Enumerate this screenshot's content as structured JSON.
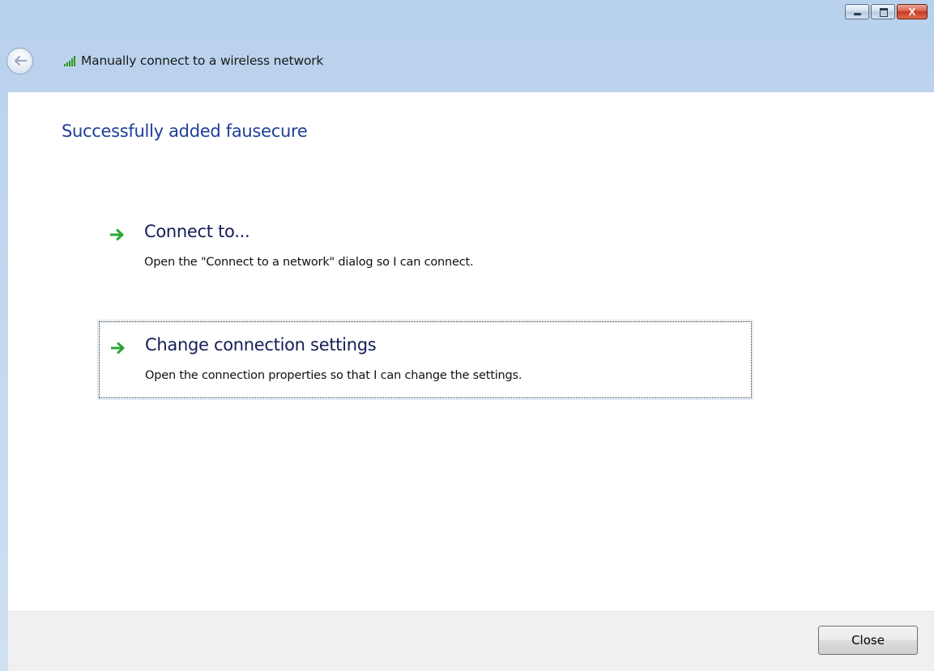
{
  "window": {
    "controls": {
      "close_glyph": "X"
    }
  },
  "header": {
    "title": "Manually connect to a wireless network",
    "back_icon": "back-arrow-icon",
    "signal_icon": "wireless-signal-icon"
  },
  "main": {
    "heading": "Successfully added fausecure",
    "options": [
      {
        "title": "Connect to...",
        "description": "Open the \"Connect to a network\" dialog so I can connect.",
        "icon": "green-arrow-icon"
      },
      {
        "title": "Change connection settings",
        "description": "Open the connection properties so that I can change the settings.",
        "icon": "green-arrow-icon",
        "focused": true
      }
    ]
  },
  "footer": {
    "close_label": "Close"
  },
  "colors": {
    "heading": "#1f3f97",
    "option_title": "#151c55",
    "arrow": "#2aa532",
    "titlebar": "#c6daf0"
  }
}
